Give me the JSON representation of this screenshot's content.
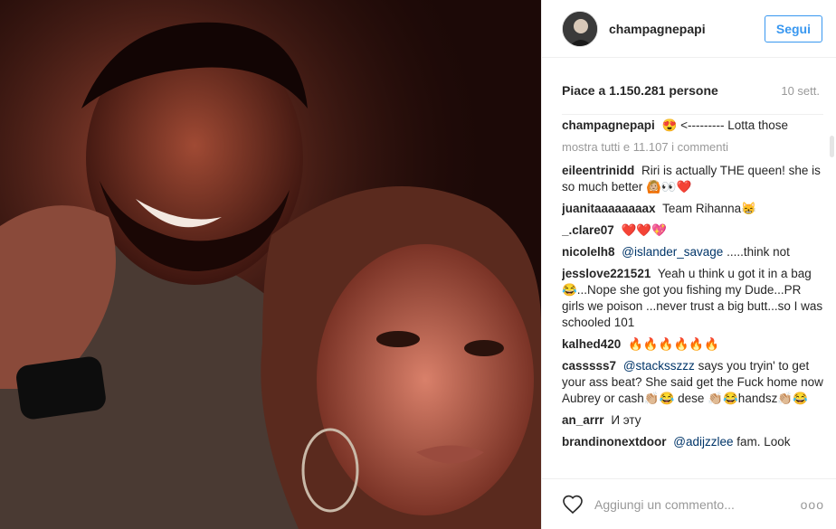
{
  "post": {
    "username": "champagnepapi",
    "follow_label": "Segui",
    "likes": "Piace a 1.150.281 persone",
    "timestamp": "10 sett.",
    "caption": {
      "user": "champagnepapi",
      "text": "😍 <--------- Lotta those"
    },
    "show_all": "mostra tutti e 11.107 i commenti",
    "comments": [
      {
        "user": "eileentrinidd",
        "text": "Riri is actually THE queen! she is so much better 🙆🏼👀❤️"
      },
      {
        "user": "juanitaaaaaaaax",
        "text": "Team Rihanna😸"
      },
      {
        "user": "_.clare07",
        "text": "❤️❤️💖"
      },
      {
        "user": "nicolelh8",
        "mention": "@islander_savage",
        "text": " .....think not"
      },
      {
        "user": "jesslove221521",
        "text": "Yeah u think u got it in a bag😂...Nope she got you fishing my Dude...PR girls we poison ...never trust a big butt...so I was schooled 101"
      },
      {
        "user": "kalhed420",
        "text": "🔥🔥🔥🔥🔥🔥"
      },
      {
        "user": "casssss7",
        "mention": "@stacksszzz",
        "text": " says you tryin' to get your ass beat? She said get the Fuck home now Aubrey or cash👏🏼😂 dese 👏🏼😂handsz👏🏼😂"
      },
      {
        "user": "an_arrr",
        "text": "И эту"
      },
      {
        "user": "brandinonextdoor",
        "mention": "@adijzzlee",
        "text": " fam. Look"
      }
    ],
    "comment_placeholder": "Aggiungi un commento...",
    "more_label": "ooo"
  },
  "icons": {
    "heart": "heart-outline-icon",
    "more": "more-options-icon"
  },
  "colors": {
    "accent": "#3897f0",
    "muted": "#999999",
    "border": "#efefef"
  }
}
